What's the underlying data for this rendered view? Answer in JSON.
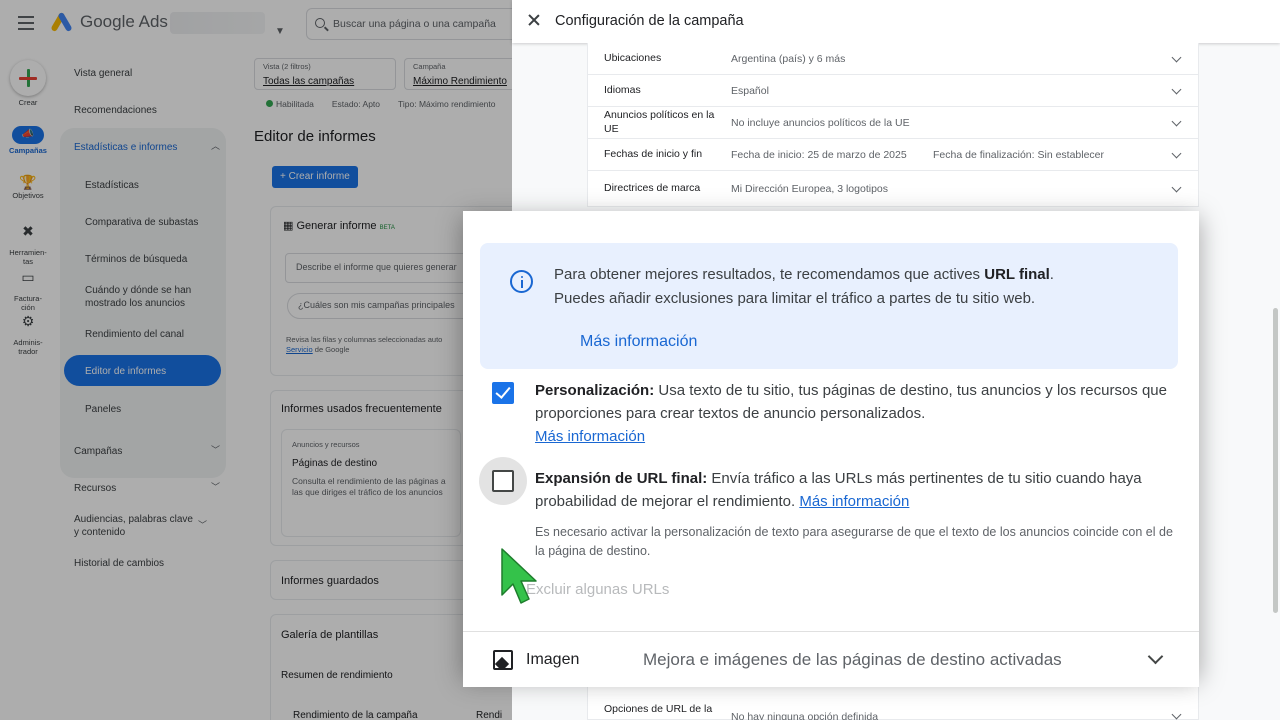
{
  "app": {
    "logo_text": "Google Ads",
    "search_placeholder": "Buscar una página o una campaña"
  },
  "rail": {
    "create": "Crear",
    "campaigns": "Campañas",
    "goals": "Objetivos",
    "tools": "Herramien-\ntas",
    "billing": "Factura-\nción",
    "admin": "Adminis-\ntrador"
  },
  "nav": {
    "overview": "Vista general",
    "recommendations": "Recomendaciones",
    "insights": "Estadísticas e informes",
    "statistics": "Estadísticas",
    "auction": "Comparativa de subastas",
    "search_terms": "Términos de búsqueda",
    "when_where": "Cuándo y dónde se han mostrado los anuncios",
    "channel": "Rendimiento del canal",
    "report_editor": "Editor de informes",
    "dashboards": "Paneles",
    "campaigns": "Campañas",
    "resources": "Recursos",
    "audiences": "Audiencias, palabras clave y contenido",
    "history": "Historial de cambios"
  },
  "main": {
    "view_label": "Vista (2 filtros)",
    "view_value": "Todas las campañas",
    "campaign_label": "Campaña",
    "campaign_value": "Máximo Rendimiento",
    "status_enabled": "Habilitada",
    "status_label": "Estado: Apto",
    "type_label": "Tipo: Máximo rendimiento",
    "page_title": "Editor de informes",
    "create_report": "Crear informe",
    "generate_title": "Generar informe",
    "beta": "BETA",
    "describe_placeholder": "Describe el informe que quieres generar",
    "suggestion": "¿Cuáles son mis campañas principales",
    "review_text": "Revisa las filas y columnas seleccionadas auto",
    "service_link": "Servicio",
    "service_suffix": "de Google",
    "frequent_title": "Informes usados frecuentemente",
    "card_category": "Anuncios y recursos",
    "card_title": "Páginas de destino",
    "card_desc": "Consulta el rendimiento de las páginas a las que diriges el tráfico de los anuncios",
    "saved_title": "Informes guardados",
    "gallery_title": "Galería de plantillas",
    "gallery_summary": "Resumen de rendimiento",
    "gallery_item1": "Rendimiento de la campaña",
    "gallery_item2": "Rendi"
  },
  "panel": {
    "title": "Configuración de la campaña",
    "rows": [
      {
        "label": "Ubicaciones",
        "value": "Argentina (país) y 6 más"
      },
      {
        "label": "Idiomas",
        "value": "Español"
      },
      {
        "label": "Anuncios políticos en la UE",
        "value": "No incluye anuncios políticos de la UE"
      },
      {
        "label": "Fechas de inicio y fin",
        "value": "Fecha de inicio: 25 de marzo de 2025",
        "value2": "Fecha de finalización: Sin establecer"
      },
      {
        "label": "Directrices de marca",
        "value": "Mi Dirección Europea, 3 logotipos"
      }
    ],
    "url_options_label": "Opciones de URL de la",
    "url_options_value": "No hay ninguna opción definida"
  },
  "zoom": {
    "info_prefix": "Para obtener mejores resultados, te recomendamos que actives ",
    "info_bold": "URL final",
    "info_suffix": ".",
    "info_line2": "Puedes añadir exclusiones para limitar el tráfico a partes de tu sitio web.",
    "info_link": "Más información",
    "perso_title": "Personalización:",
    "perso_text": " Usa texto de tu sitio, tus páginas de destino, tus anuncios y los recursos que proporciones para crear textos de anuncio personalizados.",
    "perso_link": "Más información",
    "perso_checked": true,
    "exp_title": "Expansión de URL final:",
    "exp_text": " Envía tráfico a las URLs más pertinentes de tu sitio cuando haya probabilidad de mejorar el rendimiento. ",
    "exp_link": "Más información",
    "exp_checked": false,
    "exp_note": "Es necesario activar la personalización de texto para asegurarse de que el texto de los anuncios coincide con el de la página de destino.",
    "exclude": "Excluir algunas URLs",
    "image_label": "Imagen",
    "image_value": "Mejora e imágenes de las páginas de destino activadas"
  },
  "colors": {
    "accent": "#1a73e8",
    "link": "#1967d2",
    "info_bg": "#e8f0fe",
    "cursor": "#34c24a"
  }
}
